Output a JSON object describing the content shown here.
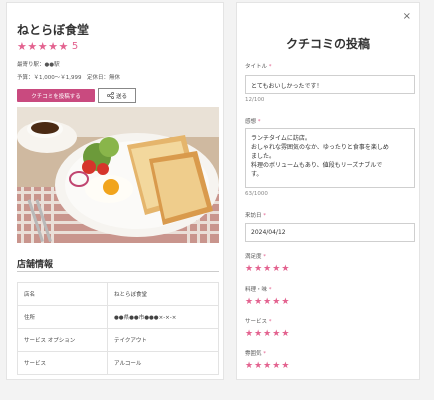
{
  "shop": {
    "name": "ねとらぼ食堂",
    "rating_display": "5",
    "rating_value": 5,
    "station": "最寄り駅：●●駅",
    "budget": "予算：￥1,000～￥1,999　定休日：無休",
    "post_button": "クチコミを投稿する",
    "send_button": "送る"
  },
  "info": {
    "title": "店舗情報",
    "rows": [
      {
        "label": "店名",
        "value": "ねとらぼ食堂"
      },
      {
        "label": "住所",
        "value": "●●県●●市●●●×-×-×"
      },
      {
        "label": "サービス オプション",
        "value": "テイクアウト"
      },
      {
        "label": "サービス",
        "value": "アルコール"
      }
    ]
  },
  "form": {
    "title": "クチコミの投稿",
    "title_label": "タイトル",
    "title_value": "とてもおいしかったです！",
    "title_counter": "12/100",
    "body_label": "感想",
    "body_lines": [
      "ランチタイムに訪店。",
      "おしゃれな雰囲気のなか、ゆったりと食事を楽しめ",
      "ました。",
      "料理のボリュームもあり、値段もリーズナブルで",
      "す。"
    ],
    "body_counter": "63/1000",
    "date_label": "来訪日",
    "date_value": "2024/04/12",
    "ratings": [
      {
        "label": "満足度",
        "stars": 5
      },
      {
        "label": "料理・味",
        "stars": 5
      },
      {
        "label": "サービス",
        "stars": 5
      },
      {
        "label": "雰囲気",
        "stars": 5
      }
    ],
    "required_mark": "*",
    "close_label": "×"
  },
  "colors": {
    "accent": "#e3628f",
    "button": "#c94a7f"
  }
}
